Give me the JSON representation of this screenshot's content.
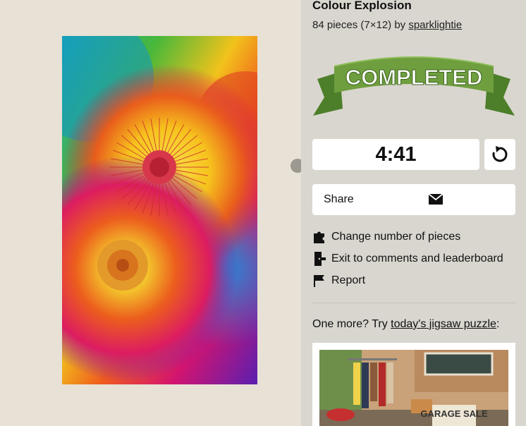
{
  "puzzle": {
    "title": "Colour Explosion",
    "pieces_text": "84 pieces (7×12) by",
    "author": "sparklightie"
  },
  "banner": {
    "text": "COMPLETED",
    "color": "#6f9e3f"
  },
  "timer": {
    "value": "4:41"
  },
  "share": {
    "label": "Share"
  },
  "menu": {
    "change_pieces": "Change number of pieces",
    "exit": "Exit to comments and leaderboard",
    "report": "Report"
  },
  "promo": {
    "prefix": "One more? Try",
    "link": "today's jigsaw puzzle",
    "suffix": ":",
    "sign_text": "GARAGE SALE"
  },
  "icons": {
    "restart": "restart-icon",
    "share": "envelope-icon",
    "change_pieces": "puzzle-piece-icon",
    "exit": "exit-door-icon",
    "report": "flag-icon"
  }
}
